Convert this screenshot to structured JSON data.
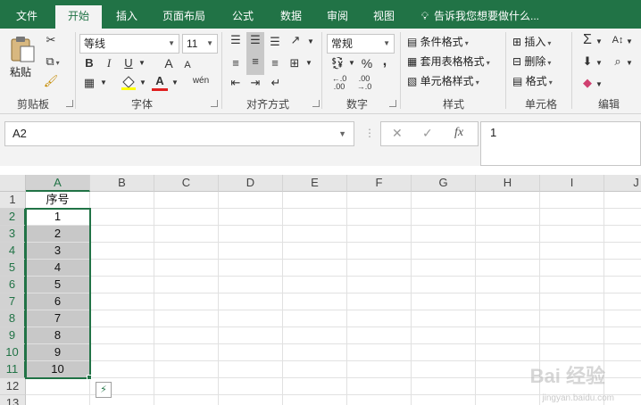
{
  "tabs": [
    "文件",
    "开始",
    "插入",
    "页面布局",
    "公式",
    "数据",
    "审阅",
    "视图"
  ],
  "active_tab": "开始",
  "tell_me": "告诉我您想要做什么...",
  "ribbon": {
    "clipboard": {
      "paste": "粘贴",
      "label": "剪贴板"
    },
    "font": {
      "name": "等线",
      "size": "11",
      "label": "字体",
      "bold": "B",
      "italic": "I",
      "underline": "U",
      "grow": "A",
      "shrink": "A",
      "font_color_letter": "A",
      "phonetic": "wén"
    },
    "alignment": {
      "label": "对齐方式"
    },
    "number": {
      "format": "常规",
      "percent": "%",
      "comma": ",",
      "label": "数字"
    },
    "styles": {
      "conditional": "条件格式",
      "table": "套用表格格式",
      "cell_styles": "单元格样式",
      "label": "样式"
    },
    "cells": {
      "insert": "插入",
      "delete": "删除",
      "format": "格式",
      "label": "单元格"
    },
    "editing": {
      "label": "编辑"
    }
  },
  "formula_bar": {
    "name_box": "A2",
    "cancel": "✕",
    "enter": "✓",
    "fx": "fx",
    "content": "1"
  },
  "sheet": {
    "columns": [
      "A",
      "B",
      "C",
      "D",
      "E",
      "F",
      "G",
      "H",
      "I",
      "J"
    ],
    "rows": [
      "1",
      "2",
      "3",
      "4",
      "5",
      "6",
      "7",
      "8",
      "9",
      "10",
      "11",
      "12",
      "13"
    ],
    "colA": [
      "序号",
      "1",
      "2",
      "3",
      "4",
      "5",
      "6",
      "7",
      "8",
      "9",
      "10",
      "",
      ""
    ]
  },
  "colors": {
    "accent": "#217346",
    "selection": "#c8c8c8"
  },
  "watermark": {
    "brand": "Bai 经验",
    "url": "jingyan.baidu.com"
  }
}
